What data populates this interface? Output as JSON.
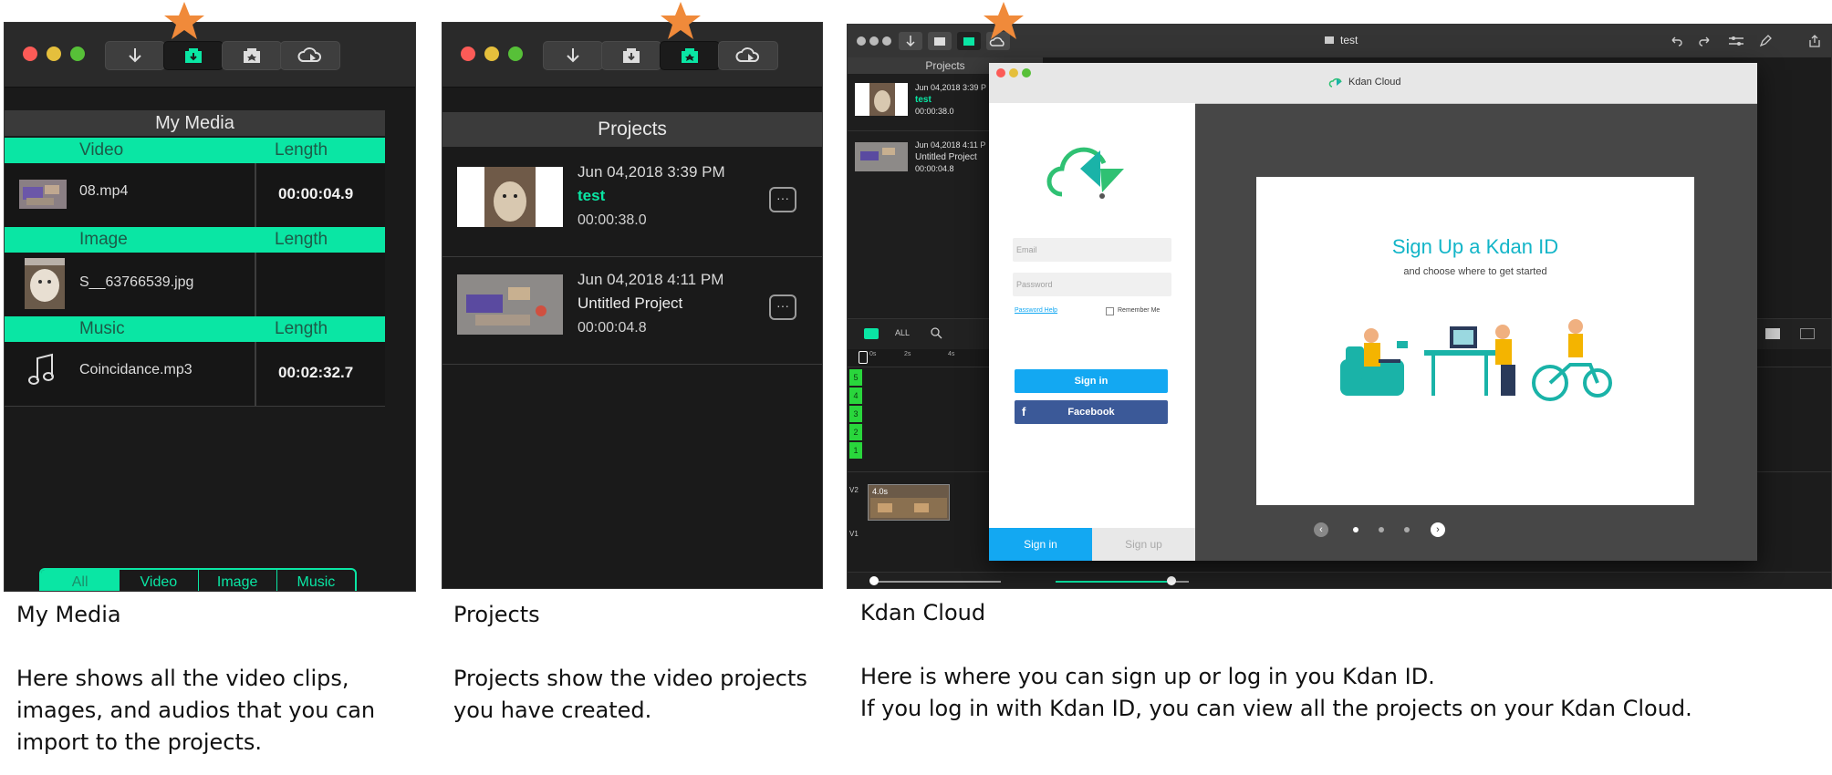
{
  "colors": {
    "accent": "#0ae6a4",
    "star": "#f08a3a",
    "kdan_blue": "#13a8f2",
    "facebook": "#3b5998"
  },
  "my_media": {
    "title": "My Media",
    "sections": [
      {
        "header": "Video",
        "length_label": "Length",
        "item": {
          "name": "08.mp4",
          "length": "00:00:04.9"
        }
      },
      {
        "header": "Image",
        "length_label": "Length",
        "item": {
          "name": "S__63766539.jpg",
          "length": ""
        }
      },
      {
        "header": "Music",
        "length_label": "Length",
        "item": {
          "name": "Coincidance.mp3",
          "length": "00:02:32.7"
        }
      }
    ],
    "filters": [
      "All",
      "Video",
      "Image",
      "Music"
    ],
    "caption_title": "My Media",
    "caption_body": [
      "Here shows all the video clips,",
      "images, and audios that you can",
      "import to the projects."
    ]
  },
  "projects": {
    "title": "Projects",
    "items": [
      {
        "date": "Jun 04,2018 3:39 PM",
        "name": "test",
        "duration": "00:00:38.0"
      },
      {
        "date": "Jun 04,2018 4:11 PM",
        "name": "Untitled Project",
        "duration": "00:00:04.8"
      }
    ],
    "more_label": "···",
    "caption_title": "Projects",
    "caption_body": [
      "Projects show the video projects",
      "you have created."
    ]
  },
  "kdan": {
    "window_title": "test",
    "sidebar_title": "Projects",
    "sidebar_items": [
      {
        "date": "Jun 04,2018 3:39 P",
        "name": "test",
        "duration": "00:00:38.0"
      },
      {
        "date": "Jun 04,2018 4:11 P",
        "name": "Untitled Project",
        "duration": "00:00:04.8"
      }
    ],
    "modal_title": "Kdan Cloud",
    "email_placeholder": "Email",
    "password_placeholder": "Password",
    "password_help": "Password Help",
    "remember_me": "Remember Me",
    "sign_in_button": "Sign in",
    "facebook_button": "Facebook",
    "tab_sign_in": "Sign in",
    "tab_sign_up": "Sign up",
    "card_title": "Sign Up a Kdan ID",
    "card_subtitle": "and choose where to get started",
    "timeline_filter": "ALL",
    "track_numbers": [
      "5",
      "4",
      "3",
      "2",
      "1"
    ],
    "track_labels": [
      "V2",
      "V1"
    ],
    "clip_label": "4.0s",
    "ruler_ticks": [
      "0s",
      "2s",
      "4s"
    ],
    "caption_title": "Kdan Cloud",
    "caption_body": [
      "Here is where you can sign up or log in you Kdan ID.",
      "If you log in with Kdan ID, you can view all the projects on your Kdan Cloud."
    ]
  }
}
